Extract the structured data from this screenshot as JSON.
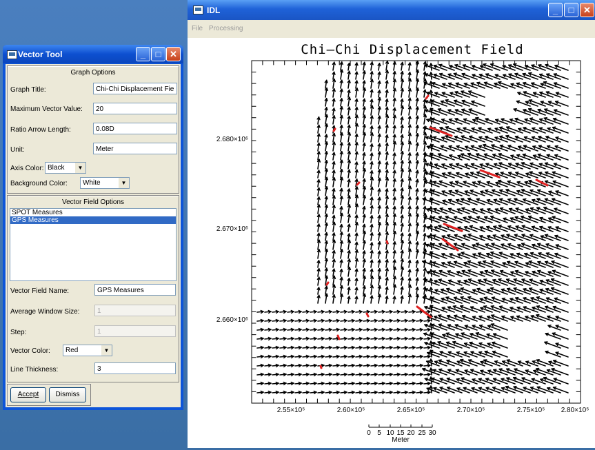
{
  "idl_window": {
    "title": "IDL",
    "menu": [
      "File",
      "Processing"
    ],
    "plot": {
      "title": "Chi–Chi Displacement Field",
      "y_ticks": [
        "2.680×10⁶",
        "2.670×10⁶",
        "2.660×10⁶"
      ],
      "x_ticks": [
        "2.55×10⁵",
        "2.60×10⁵",
        "2.65×10⁵",
        "2.70×10⁵",
        "2.75×10⁵",
        "2.80×10⁵"
      ],
      "scale_ticks": [
        "0",
        "5",
        "10",
        "15",
        "20",
        "25",
        "30"
      ],
      "scale_unit": "Meter"
    }
  },
  "vector_tool": {
    "title": "Vector Tool",
    "graph_options": {
      "heading": "Graph Options",
      "graph_title_label": "Graph Title:",
      "graph_title_value": "Chi-Chi Displacement Fie",
      "max_vector_label": "Maximum Vector Value:",
      "max_vector_value": "20",
      "ratio_label": "Ratio Arrow Length:",
      "ratio_value": "0.08D",
      "unit_label": "Unit:",
      "unit_value": "Meter",
      "axis_color_label": "Axis Color:",
      "axis_color_value": "Black",
      "bg_color_label": "Background Color:",
      "bg_color_value": "White"
    },
    "vector_field_options": {
      "heading": "Vector Field Options",
      "items": [
        "SPOT Measures",
        "GPS Measures"
      ],
      "selected_index": 1,
      "name_label": "Vector Field Name:",
      "name_value": "GPS Measures",
      "avg_label": "Average Window Size:",
      "avg_value": "1",
      "step_label": "Step:",
      "step_value": "1",
      "color_label": "Vector Color:",
      "color_value": "Red",
      "thickness_label": "Line Thickness:",
      "thickness_value": "3"
    },
    "buttons": {
      "accept": "Accept",
      "dismiss": "Dismiss"
    }
  },
  "colors": {
    "titlebar": "#0d55d9",
    "selection": "#316ac5",
    "gps_vector": "#e02020",
    "spot_vector": "#000000"
  }
}
